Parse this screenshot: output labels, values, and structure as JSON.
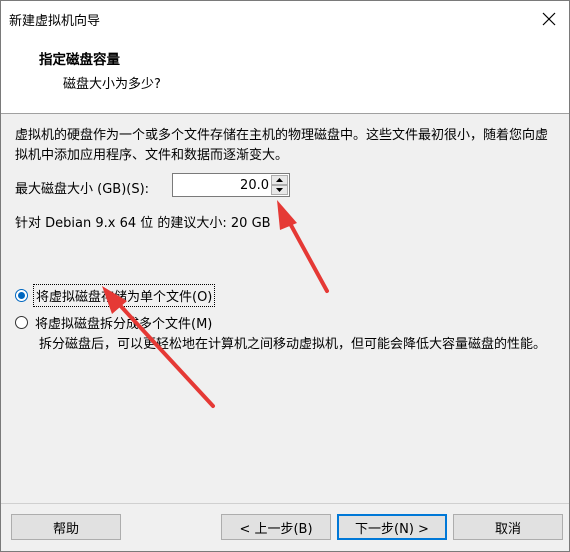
{
  "window": {
    "title": "新建虚拟机向导"
  },
  "header": {
    "title": "指定磁盘容量",
    "subtitle": "磁盘大小为多少?"
  },
  "description": "虚拟机的硬盘作为一个或多个文件存储在主机的物理磁盘中。这些文件最初很小，随着您向虚拟机中添加应用程序、文件和数据而逐渐变大。",
  "disk_size": {
    "label": "最大磁盘大小 (GB)(S):",
    "value": "20.0"
  },
  "recommended": "针对 Debian 9.x 64 位 的建议大小: 20 GB",
  "options": {
    "single_label": "将虚拟磁盘存储为单个文件(O)",
    "single_selected": true,
    "split_label": "将虚拟磁盘拆分成多个文件(M)",
    "split_selected": false,
    "split_note": "拆分磁盘后，可以更轻松地在计算机之间移动虚拟机，但可能会降低大容量磁盘的性能。"
  },
  "buttons": {
    "help": "帮助",
    "back": "< 上一步(B)",
    "next": "下一步(N) >",
    "cancel": "取消"
  },
  "colors": {
    "arrow": "#e53935",
    "accent": "#0067c0"
  }
}
